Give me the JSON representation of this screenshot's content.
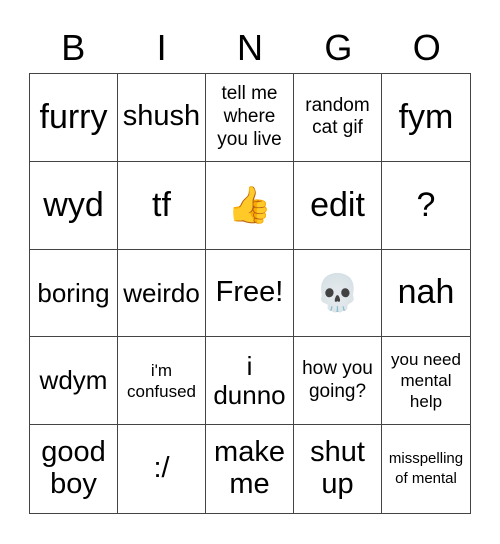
{
  "header": {
    "letters": [
      "B",
      "I",
      "N",
      "G",
      "O"
    ]
  },
  "cells": [
    {
      "text": "furry",
      "size": "s36"
    },
    {
      "text": "shush",
      "size": "s30"
    },
    {
      "text": "tell me where you live",
      "size": "s20"
    },
    {
      "text": "random cat gif",
      "size": "s20"
    },
    {
      "text": "fym",
      "size": "s36"
    },
    {
      "text": "wyd",
      "size": "s36"
    },
    {
      "text": "tf",
      "size": "s36"
    },
    {
      "text": "👍",
      "size": "emoji",
      "icon": "thumbs-up-icon"
    },
    {
      "text": "edit",
      "size": "s36"
    },
    {
      "text": "?",
      "size": "s36"
    },
    {
      "text": "boring",
      "size": "s26"
    },
    {
      "text": "weirdo",
      "size": "s26"
    },
    {
      "text": "Free!",
      "size": "s30"
    },
    {
      "text": "💀",
      "size": "emoji",
      "icon": "skull-icon"
    },
    {
      "text": "nah",
      "size": "s36"
    },
    {
      "text": "wdym",
      "size": "s26"
    },
    {
      "text": "i'm confused",
      "size": "s17"
    },
    {
      "text": "i dunno",
      "size": "s26"
    },
    {
      "text": "how you going?",
      "size": "s20"
    },
    {
      "text": "you need mental help",
      "size": "s17"
    },
    {
      "text": "good boy",
      "size": "s30"
    },
    {
      "text": ":/",
      "size": "s30"
    },
    {
      "text": "make me",
      "size": "s30"
    },
    {
      "text": "shut up",
      "size": "s30"
    },
    {
      "text": "misspelling of mental",
      "size": "s14"
    }
  ]
}
